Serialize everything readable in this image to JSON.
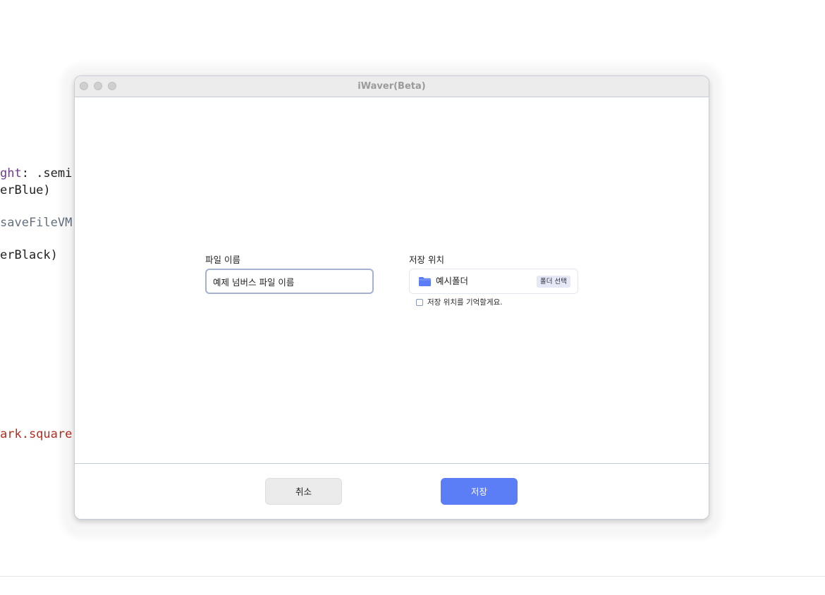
{
  "background_code": {
    "line1_purple": "ght",
    "line1_black": ": .semi",
    "line2": "erBlue)",
    "line3": "saveFileVM",
    "line4": "erBlack)",
    "line5": "ark.square"
  },
  "window": {
    "title": "iWaver(Beta)"
  },
  "form": {
    "filename_label": "파일 이름",
    "filename_value": "예제 넘버스 파일 이름",
    "location_label": "저장 위치",
    "folder_name": "예시폴더",
    "folder_select_label": "폴더 선택",
    "remember_label": "저장 위치를 기억할게요.",
    "remember_checked": false
  },
  "footer": {
    "cancel_label": "취소",
    "save_label": "저장"
  },
  "colors": {
    "accent": "#5b7df5",
    "folder_icon": "#5b7df5"
  }
}
